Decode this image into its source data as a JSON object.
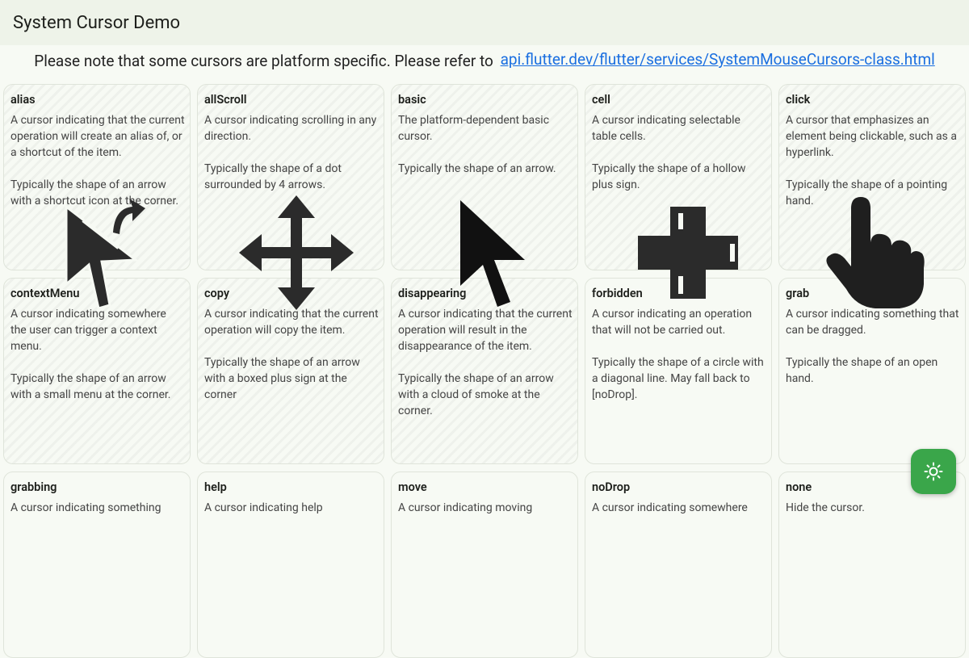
{
  "appbar": {
    "title": "System Cursor Demo"
  },
  "note": {
    "text": "Please note that some cursors are platform specific. Please refer to",
    "link": "api.flutter.dev/flutter/services/SystemMouseCursors-class.html"
  },
  "cards": [
    {
      "title": "alias",
      "desc": "A cursor indicating that the current operation will create an alias of, or a shortcut of the item.\n\nTypically the shape of an arrow with a shortcut icon at the corner."
    },
    {
      "title": "allScroll",
      "desc": "A cursor indicating scrolling in any direction.\n\nTypically the shape of a dot surrounded by 4 arrows."
    },
    {
      "title": "basic",
      "desc": "The platform-dependent basic cursor.\n\nTypically the shape of an arrow."
    },
    {
      "title": "cell",
      "desc": "A cursor indicating selectable table cells.\n\nTypically the shape of a hollow plus sign."
    },
    {
      "title": "click",
      "desc": "A cursor that emphasizes an element being clickable, such as a hyperlink.\n\nTypically the shape of a pointing hand."
    },
    {
      "title": "contextMenu",
      "desc": "A cursor indicating somewhere the user can trigger a context menu.\n\nTypically the shape of an arrow with a small menu at the corner."
    },
    {
      "title": "copy",
      "desc": "A cursor indicating that the current operation will copy the item.\n\nTypically the shape of an arrow with a boxed plus sign at the corner"
    },
    {
      "title": "disappearing",
      "desc": "A cursor indicating that the current operation will result in the disappearance of the item.\n\nTypically the shape of an arrow with a cloud of smoke at the corner."
    },
    {
      "title": "forbidden",
      "desc": "A cursor indicating an operation that will not be carried out.\n\nTypically the shape of a circle with a diagonal line. May fall back to [noDrop]."
    },
    {
      "title": "grab",
      "desc": "A cursor indicating something that can be dragged.\n\nTypically the shape of an open hand."
    },
    {
      "title": "grabbing",
      "desc": "A cursor indicating something"
    },
    {
      "title": "help",
      "desc": "A cursor indicating help"
    },
    {
      "title": "move",
      "desc": "A cursor indicating moving"
    },
    {
      "title": "noDrop",
      "desc": "A cursor indicating somewhere"
    },
    {
      "title": "none",
      "desc": "Hide the cursor."
    }
  ],
  "fab": {
    "icon": "brightness-icon"
  },
  "cursor_icons": [
    "alias-cursor-icon",
    "all-scroll-cursor-icon",
    "basic-arrow-cursor-icon",
    "cell-plus-cursor-icon",
    "pointing-hand-cursor-icon"
  ]
}
